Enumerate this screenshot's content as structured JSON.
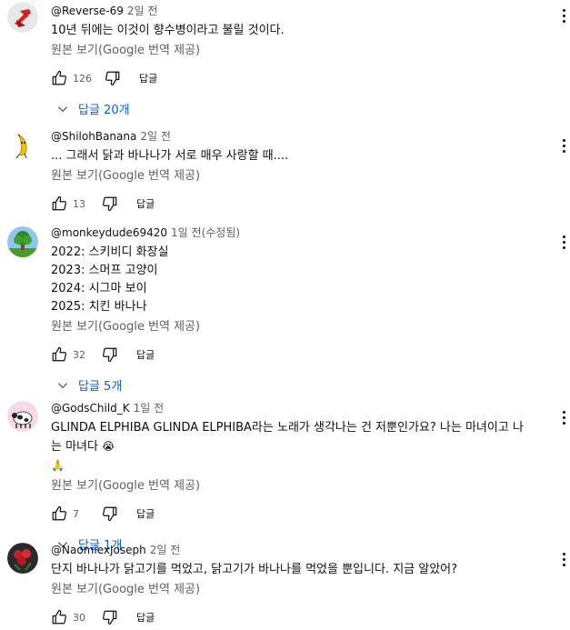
{
  "translate_label": "원본 보기(Google 번역 제공)",
  "reply_label": "답글",
  "comments": [
    {
      "handle": "@Reverse-69",
      "time": "2일 전",
      "text": "10년 뒤에는 이것이 향수병이라고 불릴 것이다.",
      "likes": "126",
      "replies": "답글 20개",
      "avatar": "red-arrow-logo"
    },
    {
      "handle": "@ShilohBanana",
      "time": "2일 전",
      "text": "... 그래서 닭과 바나나가 서로 매우 사랑할 때....",
      "likes": "13",
      "avatar": "banana-icon"
    },
    {
      "handle": "@monkeydude69420",
      "time": "1일 전(수정됨)",
      "text": "2022: 스키비디 화장실\n2023: 스머프 고양이\n2024: 시그마 보이\n2025: 치킨 바나나",
      "likes": "32",
      "replies": "답글 5개",
      "avatar": "tree-icon"
    },
    {
      "handle": "@GodsChild_K",
      "time": "1일 전",
      "text": "GLINDA ELPHIBA GLINDA ELPHIBA라는 노래가 생각나는 건 저뿐인가요? 나는 마녀이고 나는 마녀다",
      "emoji_crying": "😭",
      "emoji_pray": "🙏",
      "likes": "7",
      "replies": "답글 1개",
      "avatar": "cow-icon"
    },
    {
      "handle": "@NaomiexJoseph",
      "time": "2일 전",
      "text": "단지 바나나가 닭고기를 먹었고, 닭고기가 바나나를 먹었을 뿐입니다. 지금 알았어?",
      "likes": "30",
      "avatar": "roses-icon"
    }
  ]
}
